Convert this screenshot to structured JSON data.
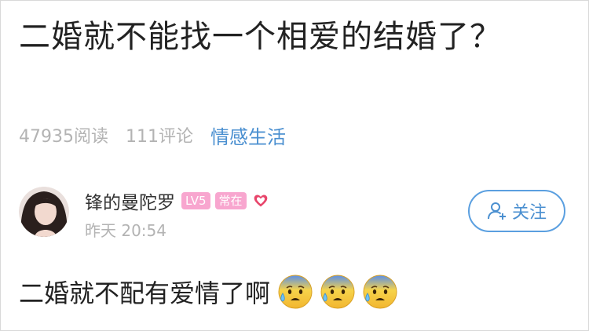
{
  "question": {
    "title": "二婚就不能找一个相爱的结婚了？"
  },
  "meta": {
    "reads": "47935阅读",
    "comments": "111评论",
    "category": "情感生活"
  },
  "author": {
    "name": "锋的曼陀罗",
    "level_badge": "LV5",
    "status_badge": "常在",
    "timestamp": "昨天 20:54"
  },
  "follow_button": {
    "label": "关注"
  },
  "answer": {
    "text": "二婚就不配有爱情了啊",
    "emoji_count": 3,
    "emoji_icon": "anxious-sweat-face-icon"
  },
  "colors": {
    "accent_blue": "#4a8fd0",
    "badge_pink": "#f8a6cf",
    "heart_red": "#e8456b",
    "muted_gray": "#b3b3b3"
  }
}
